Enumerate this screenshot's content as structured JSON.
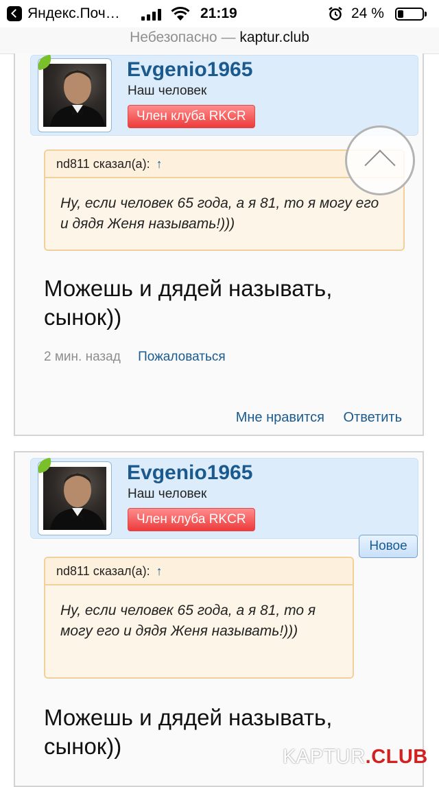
{
  "status_bar": {
    "app_name": "Яндекс.Поч…",
    "time": "21:19",
    "battery_percent": "24 %",
    "battery_level": 0.24
  },
  "address_bar": {
    "security_label": "Небезопасно",
    "separator": "—",
    "domain": "kaptur.club"
  },
  "posts": [
    {
      "username": "Evgenio1965",
      "user_title": "Наш человек",
      "banner": "Член клуба RKCR",
      "quote_author": "nd811 сказал(а):",
      "quote_arrow": "↑",
      "quote_text": "Ну, если человек 65 года, а я 81, то я могу его и дядя Женя называть!)))",
      "message": "Можешь и дядей называть, сынок))",
      "time": "2 мин. назад",
      "report": "Пожаловаться",
      "like": "Мне нравится",
      "reply": "Ответить"
    },
    {
      "username": "Evgenio1965",
      "user_title": "Наш человек",
      "banner": "Член клуба RKCR",
      "badge": "Новое",
      "quote_author": "nd811 сказал(а):",
      "quote_arrow": "↑",
      "quote_text": "Ну, если человек 65 года, а я 81, то я могу его и дядя Женя называть!)))",
      "message": "Можешь и дядей называть, сынок))"
    }
  ],
  "watermark": {
    "part1": "KAPTUR",
    "part2": ".CLUB"
  },
  "icons": {
    "back": "back-arrow-icon",
    "signal": "cellular-signal-icon",
    "wifi": "wifi-icon",
    "alarm": "alarm-clock-icon",
    "battery": "battery-icon",
    "scroll_top": "chevron-up-icon",
    "leaf": "leaf-icon"
  },
  "colors": {
    "username": "#1a5a8f",
    "banner": "#ec3b3b",
    "quote_border": "#f2d09c",
    "userbar_bg": "#dcecfb"
  }
}
